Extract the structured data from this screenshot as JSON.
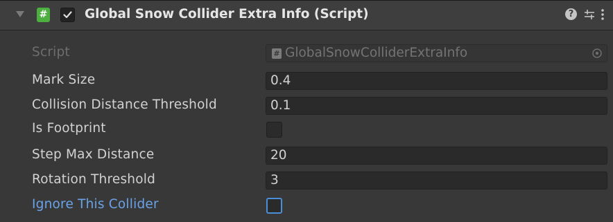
{
  "component": {
    "title": "Global Snow Collider Extra Info (Script)",
    "script_icon_glyph": "#",
    "enabled": true,
    "header_icons": [
      "help-icon",
      "preset-icon",
      "context-menu-icon"
    ],
    "help_glyph": "?"
  },
  "fields": {
    "script": {
      "label": "Script",
      "value": "GlobalSnowColliderExtraInfo",
      "icon_glyph": "#"
    },
    "mark_size": {
      "label": "Mark Size",
      "value": "0.4"
    },
    "collision_distance_threshold": {
      "label": "Collision Distance Threshold",
      "value": "0.1"
    },
    "is_footprint": {
      "label": "Is Footprint",
      "checked": false
    },
    "step_max_distance": {
      "label": "Step Max Distance",
      "value": "20"
    },
    "rotation_threshold": {
      "label": "Rotation Threshold",
      "value": "3"
    },
    "ignore_this_collider": {
      "label": "Ignore This Collider",
      "checked": false
    }
  },
  "colors": {
    "panel_bg": "#383838",
    "header_bg": "#3e3e3e",
    "field_bg": "#2a2a2a",
    "label_text": "#d2d2d2",
    "highlight_label": "#6aa3e8",
    "script_icon": "#4caf3f"
  }
}
